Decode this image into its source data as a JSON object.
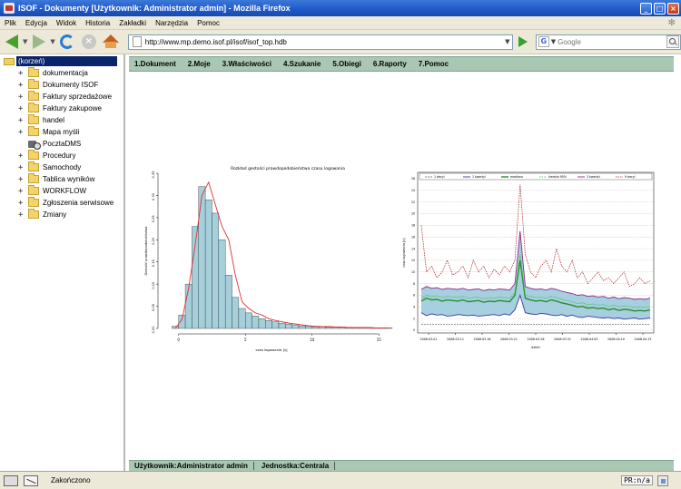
{
  "window": {
    "title": "ISOF - Dokumenty [Użytkownik: Administrator admin] - Mozilla Firefox",
    "buttons": [
      "_",
      "□",
      "×"
    ]
  },
  "menubar": [
    "Plik",
    "Edycja",
    "Widok",
    "Historia",
    "Zakładki",
    "Narzędzia",
    "Pomoc"
  ],
  "navbar": {
    "url": "http://www.mp.demo.isof.pl/isof/isof_top.hdb",
    "search_placeholder": "Google",
    "search_engine_icon": "G"
  },
  "tree": {
    "root": "(korzeń)",
    "items": [
      {
        "label": "dokumentacja",
        "icon": "folder-icon",
        "expandable": true
      },
      {
        "label": "Dokumenty ISOF",
        "icon": "folder-icon",
        "expandable": true
      },
      {
        "label": "Faktury sprzedażowe",
        "icon": "folder-icon",
        "expandable": true
      },
      {
        "label": "Faktury zakupowe",
        "icon": "folder-icon",
        "expandable": true
      },
      {
        "label": "handel",
        "icon": "folder-icon",
        "expandable": true
      },
      {
        "label": "Mapa myśli",
        "icon": "folder-icon",
        "expandable": true
      },
      {
        "label": "PocztaDMS",
        "icon": "mail-icon",
        "expandable": false
      },
      {
        "label": "Procedury",
        "icon": "folder-icon",
        "expandable": true
      },
      {
        "label": "Samochody",
        "icon": "folder-icon",
        "expandable": true
      },
      {
        "label": "Tablica wyników",
        "icon": "folder-icon",
        "expandable": true
      },
      {
        "label": "WORKFLOW",
        "icon": "folder-icon",
        "expandable": true
      },
      {
        "label": "Zgłoszenia serwisowe",
        "icon": "folder-icon",
        "expandable": true
      },
      {
        "label": "Zmiany",
        "icon": "folder-icon",
        "expandable": true
      }
    ]
  },
  "top_menu": [
    "1.Dokument",
    "2.Moje",
    "3.Właściwości",
    "4.Szukanie",
    "5.Obiegi",
    "6.Raporty",
    "7.Pomoc"
  ],
  "bottom_bar": [
    "Użytkownik:Administrator admin",
    "Jednostka:Centrala"
  ],
  "statusbar": {
    "status": "Zakończono",
    "pr": "PR:n/a"
  },
  "colors": {
    "menu_green": "#a9c7b3",
    "histogram_fill": "#a6cfdc",
    "density_line": "#e03030",
    "title_blue": "#1f58c8"
  },
  "chart_data": [
    {
      "type": "bar",
      "title": "Rozkład gestości prawdopodobieństwa czasu logowania",
      "xlabel": "czas logowania [s]",
      "ylabel": "Gestość prawdopodobieństwa",
      "xlim": [
        -1,
        16
      ],
      "ylim": [
        0,
        0.35
      ],
      "x_ticks": [
        0,
        5,
        10,
        15
      ],
      "y_ticks": [
        0,
        0.05,
        0.1,
        0.15,
        0.2,
        0.25,
        0.3,
        0.35
      ],
      "bin_width": 0.5,
      "bins_start": -0.5,
      "values": [
        0.005,
        0.03,
        0.1,
        0.23,
        0.32,
        0.29,
        0.26,
        0.2,
        0.12,
        0.07,
        0.045,
        0.035,
        0.028,
        0.022,
        0.018,
        0.015,
        0.012,
        0.01,
        0.008,
        0.006,
        0.005,
        0.004,
        0.004,
        0.003,
        0.003,
        0.003,
        0.002,
        0.002,
        0.002,
        0.002,
        0.001,
        0.001,
        0.001
      ],
      "density": [
        0,
        0.02,
        0.09,
        0.19,
        0.3,
        0.33,
        0.28,
        0.23,
        0.2,
        0.12,
        0.06,
        0.045,
        0.035,
        0.03,
        0.022,
        0.018,
        0.015,
        0.012,
        0.01,
        0.008,
        0.006,
        0.005,
        0.004,
        0.004,
        0.003,
        0.003,
        0.002,
        0.002,
        0.002,
        0.002,
        0.001,
        0.001,
        0.001
      ]
    },
    {
      "type": "line",
      "xlabel": "dzień",
      "ylabel": "czas logowania [s]",
      "x_ticks": [
        "2008.03.01",
        "2008.03.11",
        "2008.03.16",
        "2008.03.21",
        "2008.03.26",
        "2008.03.31",
        "2008.04.05",
        "2008.04.10",
        "2008.04.15"
      ],
      "y_ticks": [
        0,
        2,
        4,
        6,
        8,
        10,
        12,
        14,
        16,
        18,
        20,
        22,
        24,
        26
      ],
      "ylim": [
        0,
        26
      ],
      "legend": [
        "1 decyl",
        "1 kwartyl",
        "mediana",
        "średnia 95%",
        "3 kwartyl",
        "9 decyl"
      ],
      "series": [
        {
          "name": "1 decyl",
          "values": [
            1,
            1,
            1,
            1,
            1,
            1,
            1,
            1,
            1,
            1,
            1,
            1,
            1,
            1,
            1,
            1,
            1,
            1,
            1,
            1,
            1,
            1,
            1,
            1,
            1,
            1,
            1,
            1,
            1,
            1,
            1,
            1,
            1,
            1,
            1,
            1,
            1,
            1,
            1,
            1,
            1,
            1,
            1,
            1,
            1
          ]
        },
        {
          "name": "1 kwartyl",
          "values": [
            3,
            2.5,
            2.8,
            2.6,
            2.7,
            2.4,
            2.5,
            2.7,
            2.6,
            2.5,
            2.6,
            2.4,
            2.5,
            2.6,
            2.7,
            2.5,
            2.8,
            2.6,
            3.5,
            6,
            3,
            2.8,
            2.7,
            2.9,
            2.8,
            2.6,
            2.5,
            2.7,
            2.4,
            2.6,
            2.3,
            2.2,
            2.4,
            2.3,
            2.2,
            2.1,
            2.2,
            2.0,
            2.1,
            1.9,
            2.0,
            2.1,
            1.9,
            2.0,
            2.1
          ]
        },
        {
          "name": "mediana",
          "values": [
            5,
            5.5,
            5.2,
            5.3,
            5.0,
            5.2,
            5.1,
            5.0,
            5.2,
            4.9,
            5.0,
            5.1,
            4.8,
            5.0,
            4.9,
            5.1,
            5.0,
            4.9,
            6,
            12,
            5.5,
            5.2,
            5.0,
            5.1,
            4.9,
            5.2,
            5.0,
            4.7,
            4.5,
            4.3,
            4.0,
            4.1,
            3.8,
            3.9,
            3.7,
            3.8,
            3.5,
            3.7,
            3.4,
            3.6,
            3.5,
            3.3,
            3.4,
            3.3,
            3.5
          ]
        },
        {
          "name": "średnia 95%",
          "values": [
            5.5,
            6,
            5.8,
            5.9,
            5.6,
            5.8,
            5.7,
            5.6,
            5.8,
            5.5,
            5.6,
            5.7,
            5.4,
            5.6,
            5.5,
            5.7,
            5.6,
            5.5,
            6.5,
            13,
            6,
            5.8,
            5.6,
            5.7,
            5.5,
            5.8,
            5.6,
            5.3,
            5.1,
            4.9,
            4.6,
            4.7,
            4.4,
            4.5,
            4.3,
            4.4,
            4.1,
            4.3,
            4.0,
            4.2,
            4.1,
            3.9,
            4.0,
            3.9,
            4.1
          ]
        },
        {
          "name": "3 kwartyl",
          "values": [
            7,
            7.5,
            7.2,
            7.3,
            7.0,
            7.2,
            7.1,
            7.0,
            7.2,
            6.9,
            7.0,
            7.1,
            6.8,
            7.0,
            6.9,
            7.1,
            7.0,
            6.9,
            8,
            17,
            7.5,
            7.2,
            7.0,
            7.1,
            6.9,
            7.2,
            7.0,
            6.7,
            6.5,
            6.3,
            6.0,
            6.1,
            5.8,
            5.9,
            5.7,
            5.8,
            5.5,
            5.7,
            5.4,
            5.6,
            5.5,
            5.3,
            5.4,
            5.3,
            5.5
          ]
        },
        {
          "name": "9 decyl",
          "values": [
            18,
            10,
            11,
            9,
            10,
            12,
            9.5,
            10,
            11,
            9,
            12,
            10,
            11,
            9,
            10.5,
            9.5,
            11,
            10,
            12,
            25,
            13,
            10,
            9,
            11,
            12,
            10,
            14,
            11,
            10,
            12,
            9,
            10,
            8,
            9,
            10,
            8.5,
            9,
            8,
            9,
            10,
            7.5,
            8,
            9,
            8,
            8.5
          ]
        }
      ]
    }
  ]
}
